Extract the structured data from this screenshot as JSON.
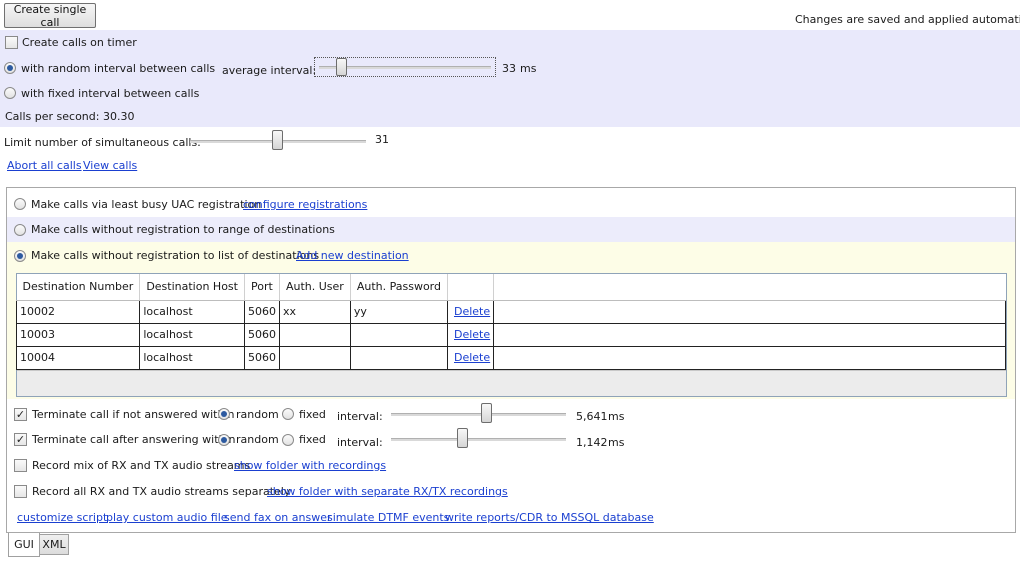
{
  "top": {
    "create_single_call": "Create single call",
    "autosave_note": "Changes are saved and applied automatically"
  },
  "timer": {
    "create_calls_on_timer": "Create calls on timer",
    "random_interval_label": "with random interval between calls",
    "average_interval_label": "average interval:",
    "average_interval_value": "33",
    "average_interval_unit": "ms",
    "fixed_interval_label": "with fixed interval between calls",
    "calls_per_second": "Calls per second:  30.30"
  },
  "limit": {
    "label": "Limit number of simultaneous calls:",
    "value": "31",
    "abort_all": "Abort all calls",
    "view_calls": "View calls"
  },
  "mode": {
    "least_busy": "Make calls via least busy UAC registration",
    "configure_registrations": "configure registrations",
    "range": "Make calls without registration to range of destinations",
    "list": "Make calls without registration to list of destinations",
    "add_destination": "Add new destination"
  },
  "table": {
    "headers": [
      "Destination Number",
      "Destination Host",
      "Port",
      "Auth. User",
      "Auth. Password",
      ""
    ],
    "rows": [
      {
        "number": "10002",
        "host": "localhost",
        "port": "5060",
        "user": "xx",
        "password": "yy",
        "action": "Delete"
      },
      {
        "number": "10003",
        "host": "localhost",
        "port": "5060",
        "user": "",
        "password": "",
        "action": "Delete"
      },
      {
        "number": "10004",
        "host": "localhost",
        "port": "5060",
        "user": "",
        "password": "",
        "action": "Delete"
      }
    ]
  },
  "terminate": {
    "not_answered": "Terminate call if not answered within",
    "after_answering": "Terminate call after answering within",
    "random": "random",
    "fixed": "fixed",
    "interval": "interval:",
    "not_answered_value": "5,641",
    "after_answering_value": "1,142",
    "unit": "ms"
  },
  "recording": {
    "mix": "Record mix of RX and TX audio streams",
    "show_folder": "show folder with recordings",
    "separate": "Record all RX and TX audio streams separately",
    "show_separate_folder": "show folder with separate RX/TX recordings"
  },
  "bottom_links": [
    "customize script",
    "play custom audio file",
    "send fax on answer",
    "simulate DTMF events",
    "write reports/CDR to MSSQL database"
  ],
  "tabs": [
    "GUI",
    "XML"
  ],
  "colors": {
    "timer_band": "#e9e9fb",
    "list_band": "#fdfde7",
    "range_band": "#ececfb",
    "link": "#1a3fd0",
    "radio_dot": "#2d5aa0"
  }
}
